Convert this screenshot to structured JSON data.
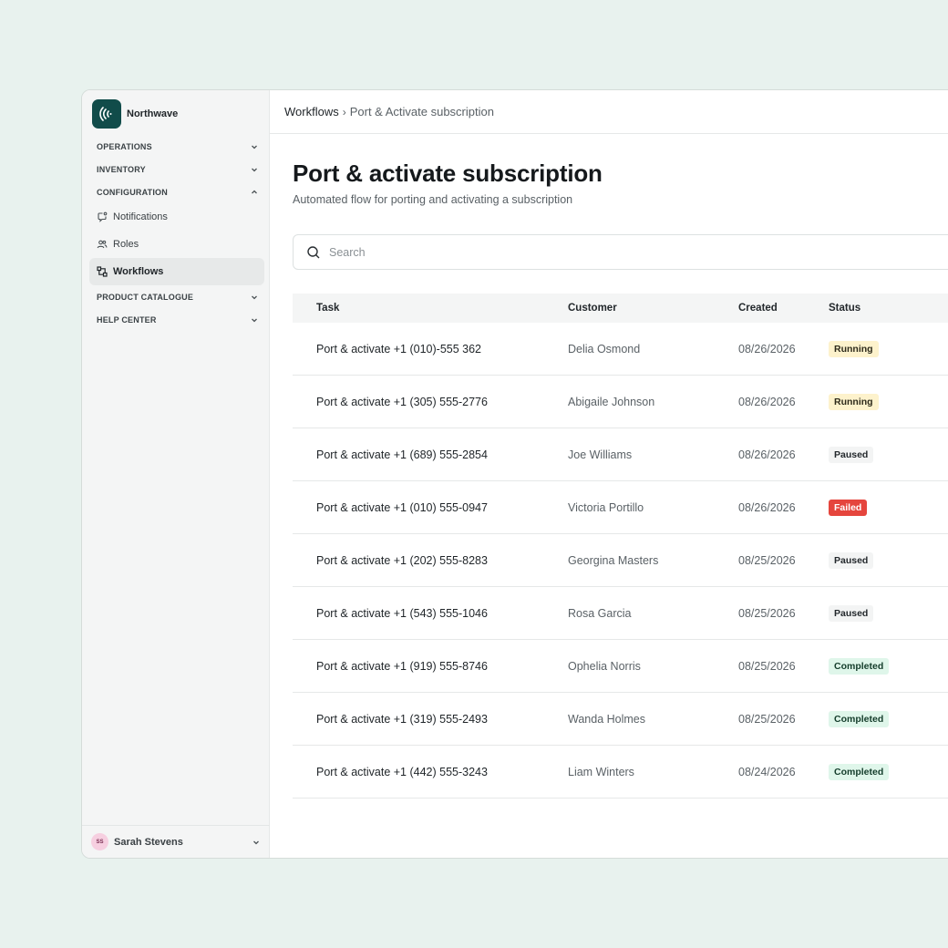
{
  "brand": {
    "name": "Northwave"
  },
  "sidebar": {
    "sections": [
      {
        "label": "OPERATIONS",
        "expanded": false
      },
      {
        "label": "INVENTORY",
        "expanded": false
      },
      {
        "label": "CONFIGURATION",
        "expanded": true
      },
      {
        "label": "PRODUCT CATALOGUE",
        "expanded": false
      },
      {
        "label": "HELP CENTER",
        "expanded": false
      }
    ],
    "config_items": [
      {
        "label": "Notifications",
        "icon": "notification-icon"
      },
      {
        "label": "Roles",
        "icon": "users-icon"
      },
      {
        "label": "Workflows",
        "icon": "workflow-icon",
        "active": true
      }
    ]
  },
  "user": {
    "initials": "SS",
    "name": "Sarah Stevens"
  },
  "breadcrumb": {
    "root": "Workflows",
    "separator": "›",
    "current": "Port & Activate subscription"
  },
  "page": {
    "title": "Port & activate subscription",
    "subtitle": "Automated flow for porting and activating a subscription"
  },
  "search": {
    "placeholder": "Search",
    "value": ""
  },
  "table": {
    "columns": {
      "task": "Task",
      "customer": "Customer",
      "created": "Created",
      "status": "Status"
    },
    "rows": [
      {
        "task": "Port & activate +1 (010)-555 362",
        "customer": "Delia Osmond",
        "created": "08/26/2026",
        "status": "Running",
        "kind": "running"
      },
      {
        "task": "Port & activate +1 (305) 555-2776",
        "customer": "Abigaile Johnson",
        "created": "08/26/2026",
        "status": "Running",
        "kind": "running"
      },
      {
        "task": "Port & activate +1 (689) 555-2854",
        "customer": "Joe Williams",
        "created": "08/26/2026",
        "status": "Paused",
        "kind": "paused"
      },
      {
        "task": "Port & activate +1 (010) 555-0947",
        "customer": "Victoria Portillo",
        "created": "08/26/2026",
        "status": "Failed",
        "kind": "failed"
      },
      {
        "task": "Port & activate +1 (202) 555-8283",
        "customer": "Georgina Masters",
        "created": "08/25/2026",
        "status": "Paused",
        "kind": "paused"
      },
      {
        "task": "Port & activate +1 (543) 555-1046",
        "customer": "Rosa Garcia",
        "created": "08/25/2026",
        "status": "Paused",
        "kind": "paused"
      },
      {
        "task": "Port & activate +1 (919) 555-8746",
        "customer": "Ophelia Norris",
        "created": "08/25/2026",
        "status": "Completed",
        "kind": "completed"
      },
      {
        "task": "Port & activate +1 (319) 555-2493",
        "customer": "Wanda Holmes",
        "created": "08/25/2026",
        "status": "Completed",
        "kind": "completed"
      },
      {
        "task": "Port & activate +1 (442) 555-3243",
        "customer": "Liam Winters",
        "created": "08/24/2026",
        "status": "Completed",
        "kind": "completed"
      }
    ]
  },
  "colors": {
    "background": "#e8f2ee",
    "brand": "#114c4a",
    "running": "#fdf2cc",
    "failed": "#e5453d",
    "completed": "#dff6ea"
  }
}
